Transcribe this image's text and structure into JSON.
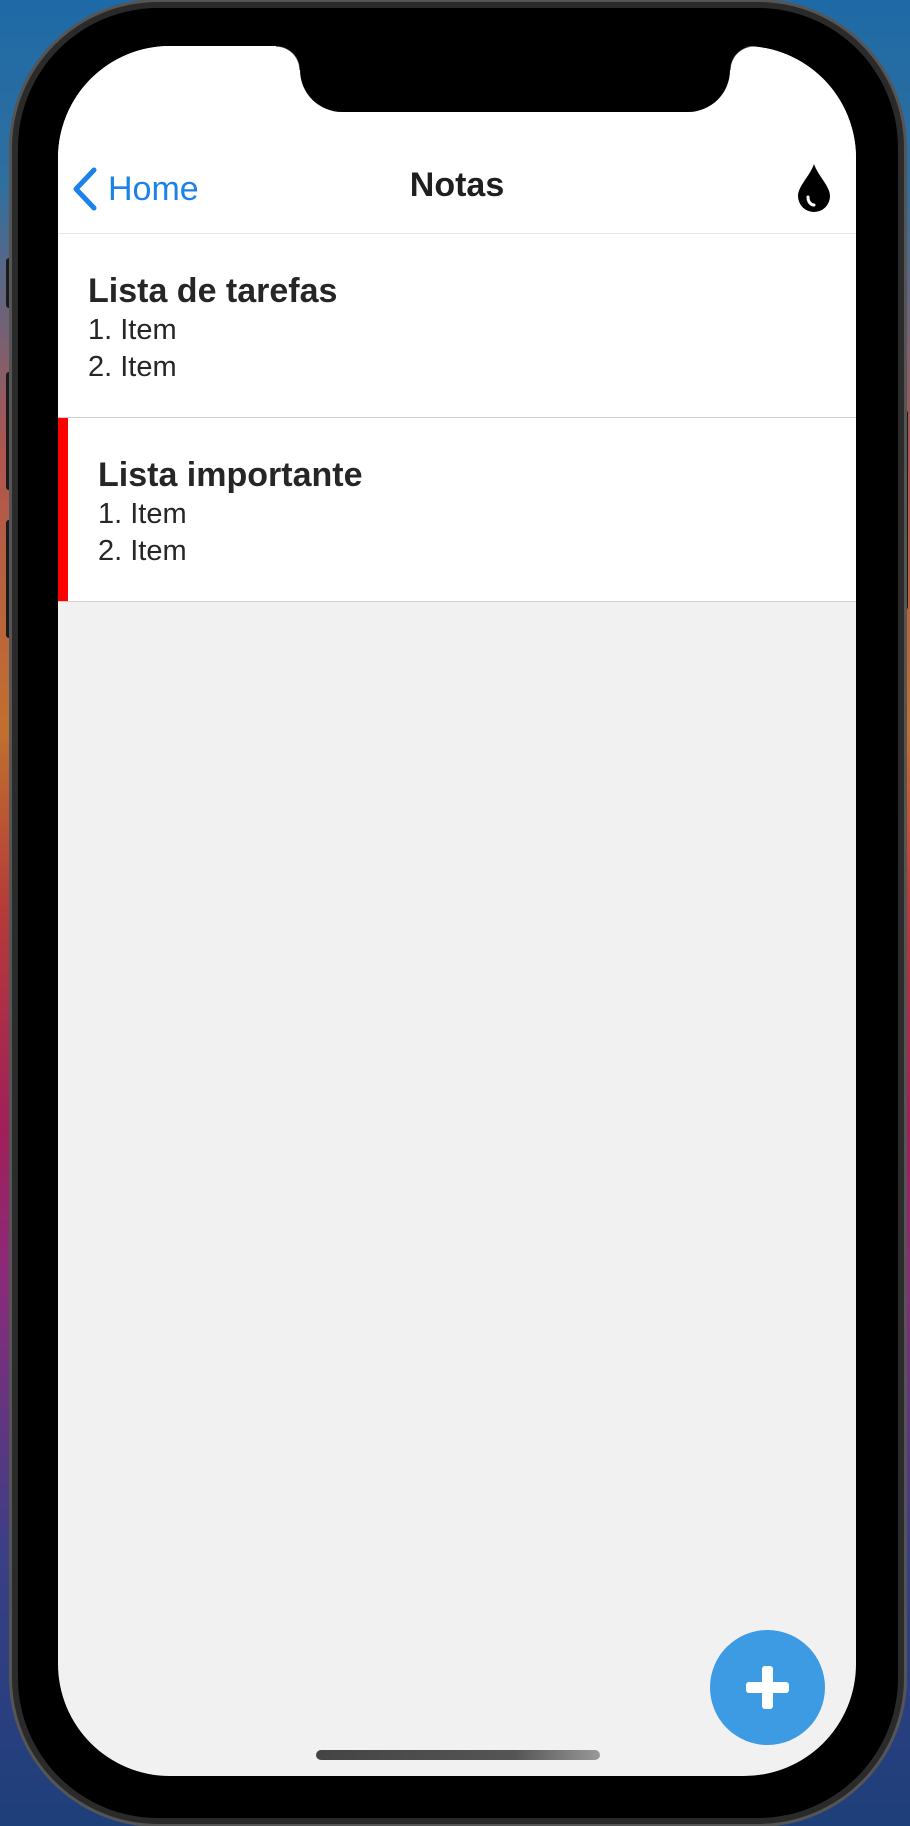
{
  "navbar": {
    "back_label": "Home",
    "title": "Notas",
    "back_icon": "chevron-left-icon",
    "theme_icon": "drop-icon"
  },
  "notes": [
    {
      "title": "Lista de tarefas",
      "lines": [
        "1. Item",
        "2. Item"
      ],
      "accent_color": null
    },
    {
      "title": "Lista importante",
      "lines": [
        "1. Item",
        "2. Item"
      ],
      "accent_color": "#ff0000"
    }
  ],
  "fab": {
    "icon": "plus-icon"
  },
  "colors": {
    "accent": "#1a82e8",
    "fab": "#3d9be3",
    "background": "#f1f1f1",
    "important": "#ff0000"
  }
}
